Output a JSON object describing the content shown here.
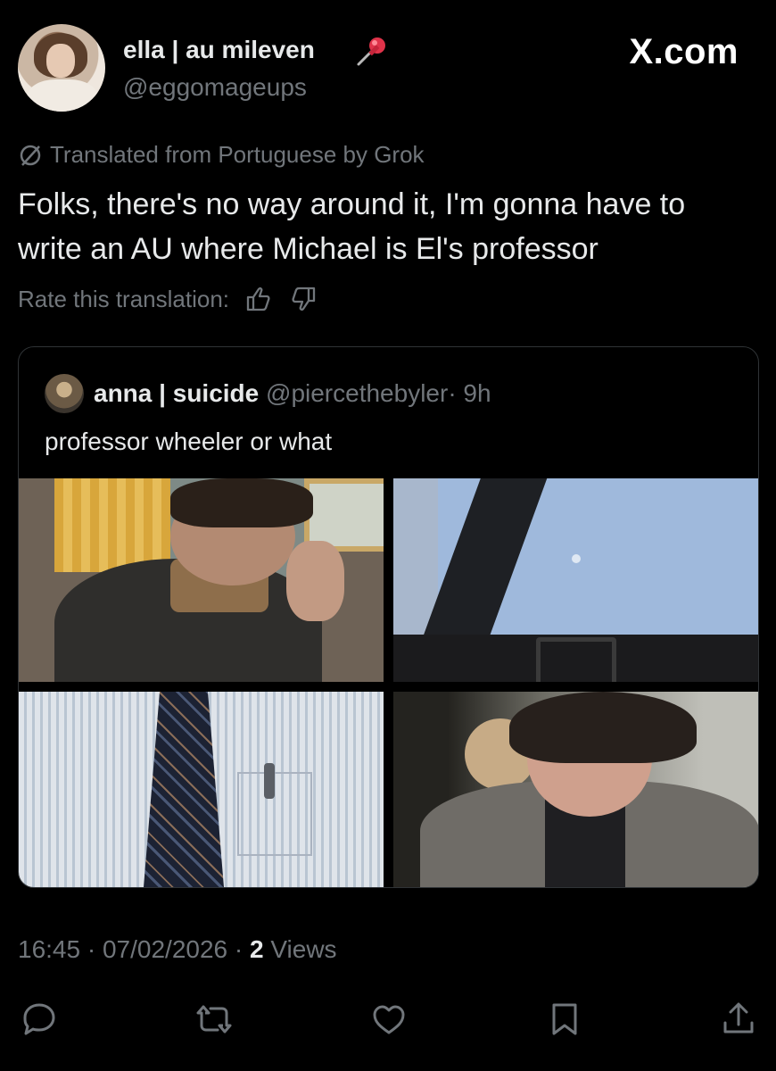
{
  "author": {
    "display_name": "ella | au mileven",
    "handle": "@eggomageups",
    "pin_icon": "pushpin-emoji-icon"
  },
  "brand": "X.com",
  "translation": {
    "notice": "Translated from Portuguese by Grok",
    "icon": "grok-slash-icon",
    "rate_label": "Rate this translation:"
  },
  "tweet": {
    "line1": "Folks, there's no way around it, I'm gonna have to",
    "line2": "write an AU where Michael is El's professor"
  },
  "quoted": {
    "name": "anna | suicide",
    "handle": "@piercethebyler",
    "time": "· 9h",
    "text": "professor wheeler or what",
    "photo_count": 4
  },
  "meta": {
    "time": "16:45",
    "date": "07/02/2026",
    "views_count": "2",
    "views_label": "Views",
    "sep": "·"
  },
  "colors": {
    "background": "#000000",
    "text": "#e7e9ea",
    "muted": "#71767b",
    "border": "#2f3336"
  },
  "actions": [
    "reply-icon",
    "repost-icon",
    "like-icon",
    "bookmark-icon",
    "share-icon"
  ]
}
